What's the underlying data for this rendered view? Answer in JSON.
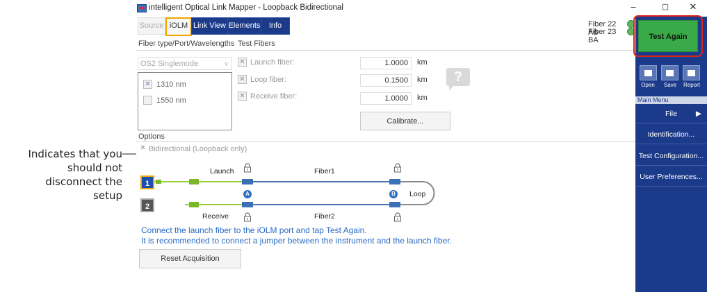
{
  "callout": {
    "line1": "Indicates that you",
    "line2": "should not",
    "line3": "disconnect the",
    "line4": "setup"
  },
  "window": {
    "title": "intelligent Optical Link Mapper - Loopback Bidirectional",
    "minimize": "–",
    "maximize": "▢",
    "close": "✕"
  },
  "tabs": [
    {
      "label": "Source"
    },
    {
      "label": "iOLM"
    },
    {
      "label": "Link View"
    },
    {
      "label": "Elements"
    },
    {
      "label": "Info"
    }
  ],
  "fiber_status": {
    "fiber1": "Fiber 22 AB",
    "fiber2": "Fiber 23 BA",
    "color": "#5cb85c"
  },
  "section_fiber": "Fiber type/Port/Wavelengths",
  "section_test_fibers": "Test Fibers",
  "fiber_type": {
    "value": "OS2 Singlemode"
  },
  "wavelengths": [
    {
      "label": "1310 nm",
      "checked": true
    },
    {
      "label": "1550 nm",
      "checked": false
    }
  ],
  "test_fibers": {
    "launch": {
      "label": "Launch fiber:",
      "value": "1.0000",
      "unit": "km"
    },
    "loop": {
      "label": "Loop fiber:",
      "value": "0.1500",
      "unit": "km"
    },
    "receive": {
      "label": "Receive fiber:",
      "value": "1.0000",
      "unit": "km"
    }
  },
  "help": "?",
  "calibrate_label": "Calibrate...",
  "options": {
    "title": "Options",
    "bidirectional": "Bidirectional (Loopback only)"
  },
  "diagram": {
    "port1": "1",
    "port2": "2",
    "launch": "Launch",
    "receive": "Receive",
    "fiber1": "Fiber1",
    "fiber2": "Fiber2",
    "point_a": "A",
    "point_b": "B",
    "loop": "Loop"
  },
  "messages": {
    "line1": "Connect the launch fiber to the iOLM port and tap Test Again.",
    "line2": "It is recommended to connect a jumper between the instrument and the launch fiber."
  },
  "reset_label": "Reset Acquisition",
  "right_panel": {
    "test_again": "Test Again",
    "tools": [
      {
        "label": "Open"
      },
      {
        "label": "Save"
      },
      {
        "label": "Report"
      }
    ],
    "main_menu": "Main Menu",
    "file": "File",
    "file_arrow": "▶",
    "identification": "Identification...",
    "test_configuration": "Test Configuration...",
    "user_preferences": "User Preferences...",
    "accent": "#1c3a8a",
    "highlight": "#d9241d",
    "button_color": "#3aa948"
  }
}
